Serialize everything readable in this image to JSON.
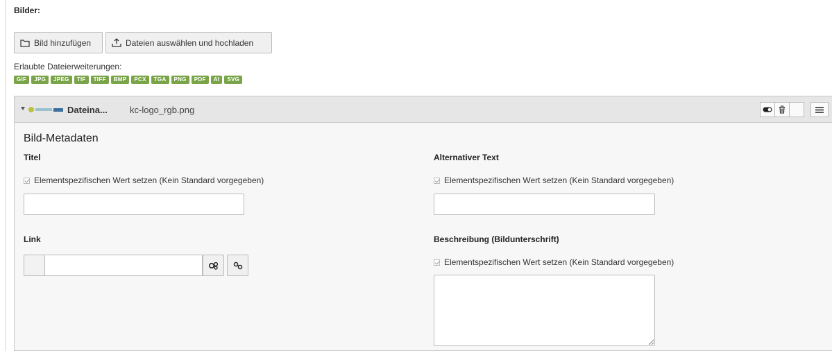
{
  "section": {
    "label": "Bilder:"
  },
  "buttons": {
    "add_image": "Bild hinzufügen",
    "upload": "Dateien auswählen und hochladen"
  },
  "extensions": {
    "label": "Erlaubte Dateierweiterungen:",
    "items": [
      "GIF",
      "JPG",
      "JPEG",
      "TIF",
      "TIFF",
      "BMP",
      "PCX",
      "TGA",
      "PNG",
      "PDF",
      "AI",
      "SVG"
    ]
  },
  "file_panel": {
    "title": "Dateina...",
    "filename": "kc-logo_rgb.png"
  },
  "metadata": {
    "heading": "Bild-Metadaten",
    "title_label": "Titel",
    "alt_label": "Alternativer Text",
    "link_label": "Link",
    "description_label": "Beschreibung (Bildunterschrift)",
    "override_text": "Elementspezifischen Wert setzen (Kein Standard vorgegeben)"
  },
  "colors": {
    "badge": "#79a548",
    "header_bg": "#e6e6e6",
    "panel_bg": "#f7f7f7"
  }
}
